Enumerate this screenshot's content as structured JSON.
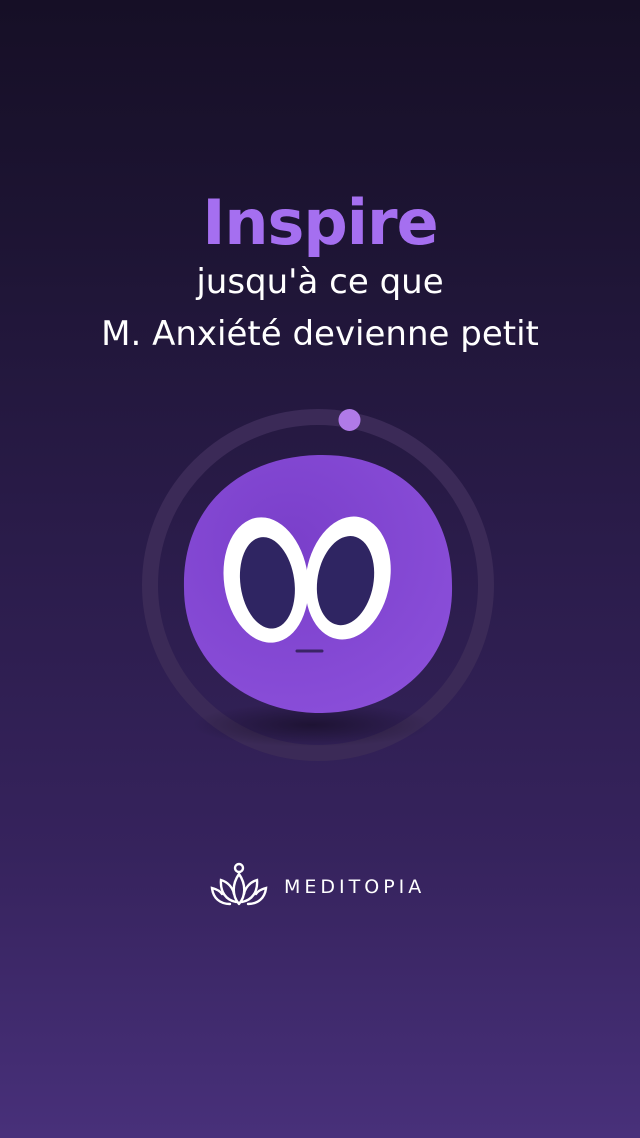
{
  "instruction": {
    "title": "Inspire",
    "line1": "jusqu'à ce que",
    "line2": "M. Anxiété devienne petit"
  },
  "breathing_progress": 0.03,
  "brand": {
    "name": "MEDITOPIA",
    "logo_icon": "lotus-icon"
  },
  "colors": {
    "accent": "#a56ff0",
    "character": "#8548d6",
    "background_top": "#160f26",
    "background_bottom": "#48307a"
  }
}
